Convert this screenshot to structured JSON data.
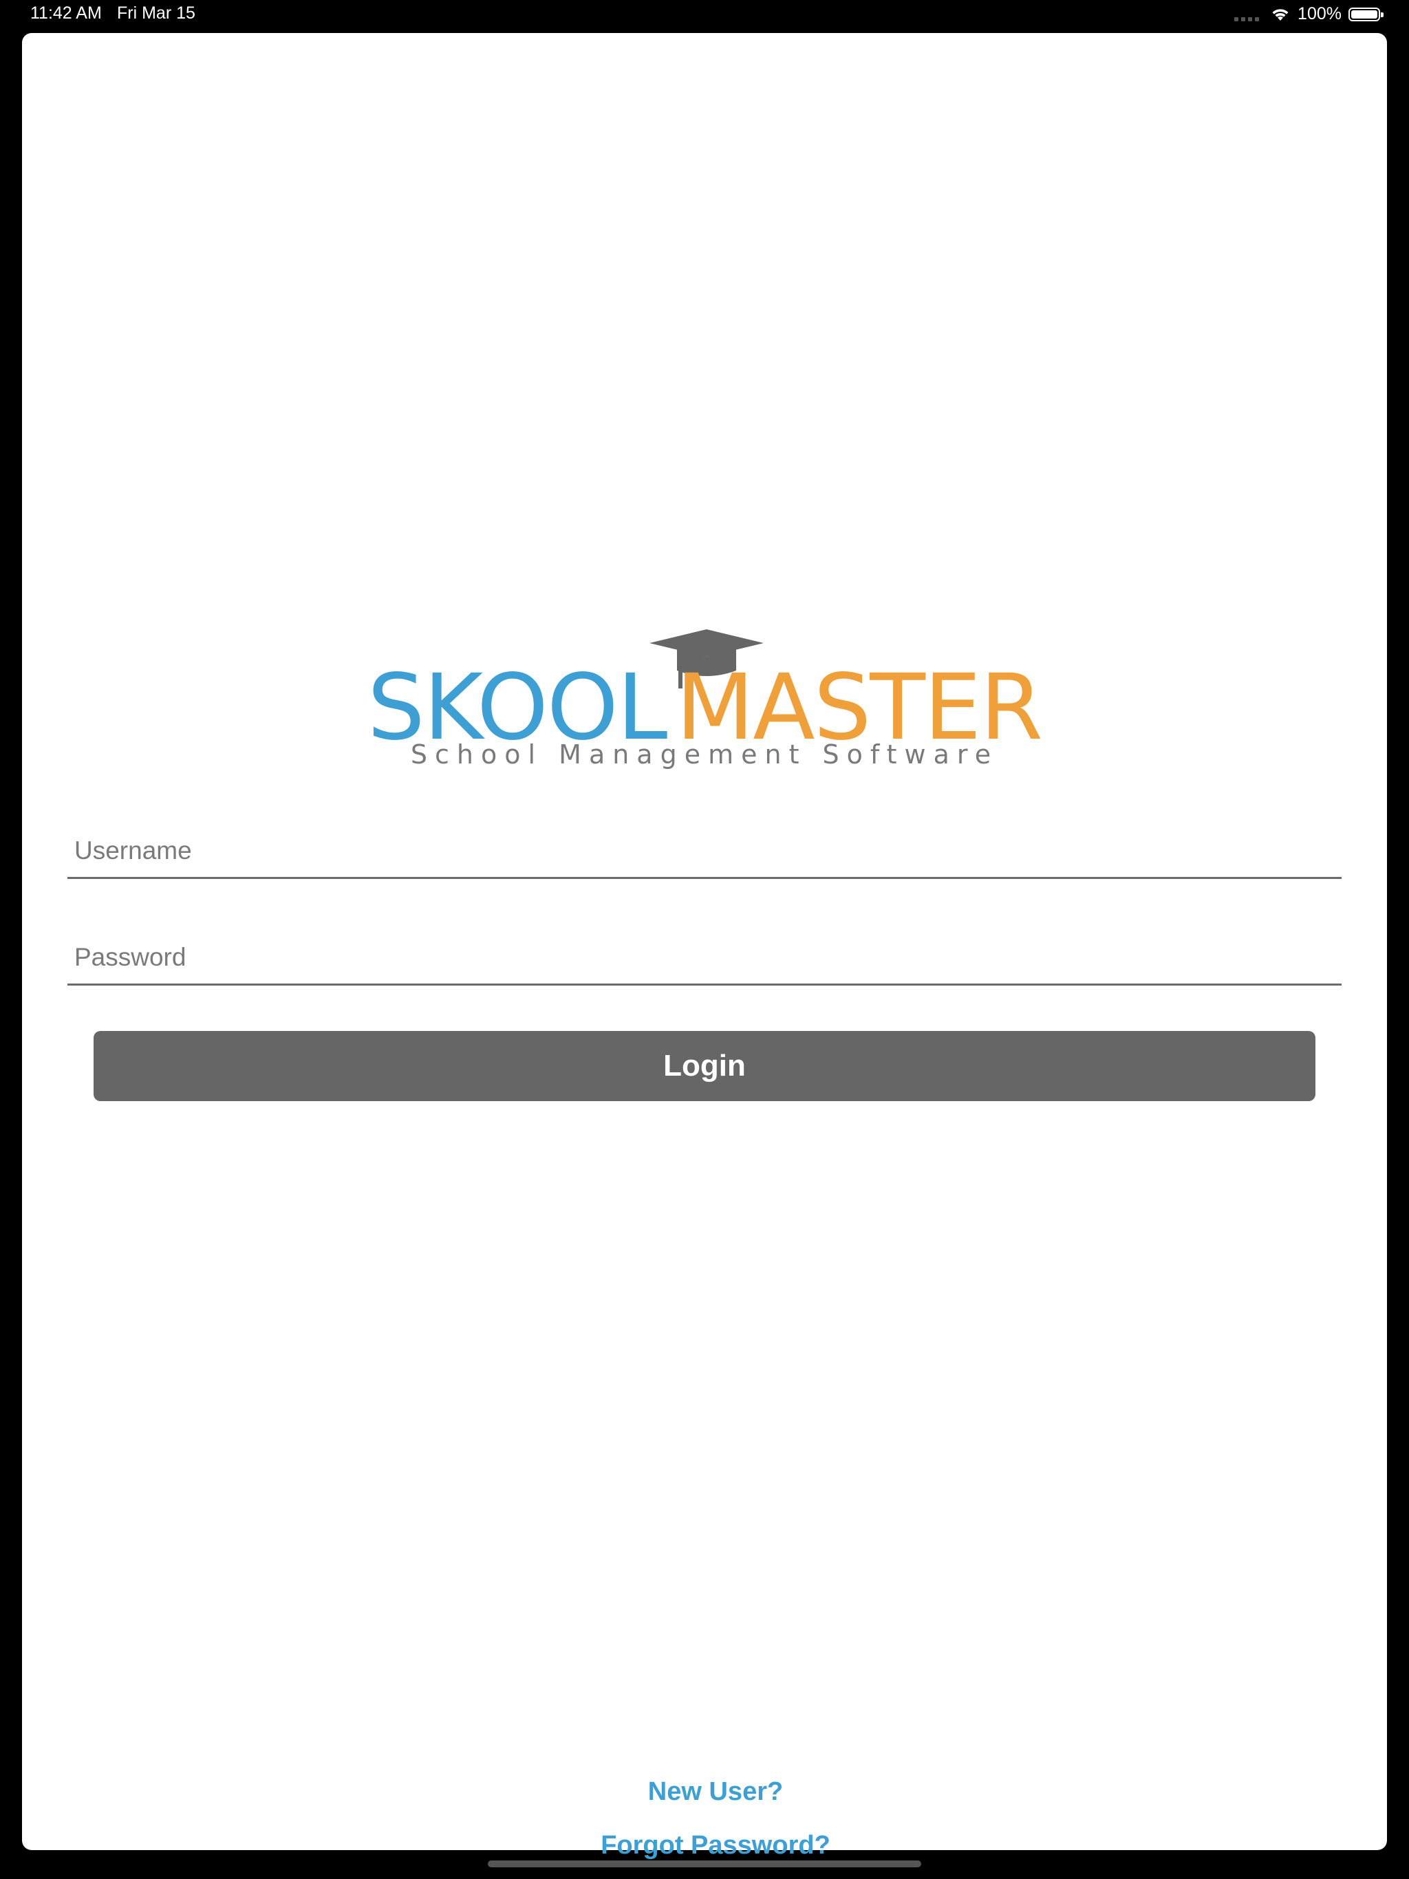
{
  "status_bar": {
    "time": "11:42 AM",
    "date": "Fri Mar 15",
    "battery": "100%",
    "battery_level": 1.0
  },
  "logo": {
    "brand_part1": "SKOOL",
    "brand_part2": "MASTER",
    "tagline": "School Management Software",
    "colors": {
      "primary": "#3d9fd3",
      "secondary": "#f0a03a",
      "cap": "#666666"
    }
  },
  "form": {
    "username_placeholder": "Username",
    "username_value": "",
    "password_placeholder": "Password",
    "password_value": "",
    "login_label": "Login"
  },
  "links": {
    "new_user": "New User?",
    "forgot_password": "Forgot Password?"
  },
  "icons": [
    "wifi-icon",
    "battery-icon",
    "cellular-icon",
    "graduation-cap-icon"
  ]
}
